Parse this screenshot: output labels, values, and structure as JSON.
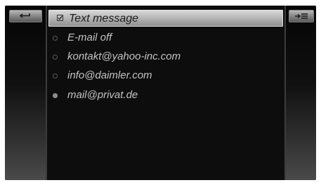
{
  "header": {
    "title": "Text message",
    "checked": true
  },
  "options": [
    {
      "label": "E-mail off",
      "selected": false
    },
    {
      "label": "kontakt@yahoo-inc.com",
      "selected": false
    },
    {
      "label": "info@daimler.com",
      "selected": false
    },
    {
      "label": "mail@privat.de",
      "selected": true
    }
  ],
  "icons": {
    "back": "back-arrow-icon",
    "menu": "menu-list-icon",
    "check": "checkbox-checked-icon"
  }
}
